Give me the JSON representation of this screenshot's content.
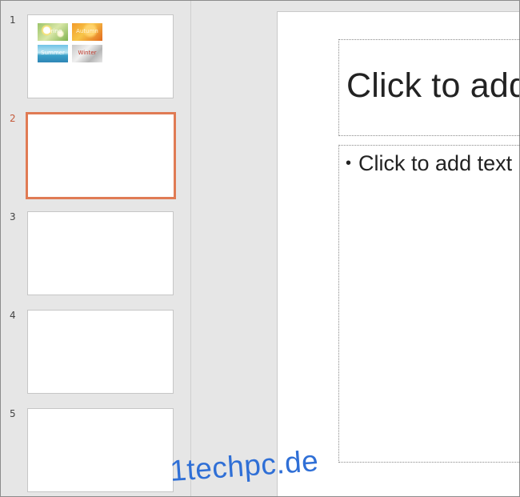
{
  "slides": [
    {
      "number": "1",
      "tiles": [
        "Spring",
        "Autumn",
        "Summer",
        "Winter"
      ]
    },
    {
      "number": "2"
    },
    {
      "number": "3"
    },
    {
      "number": "4"
    },
    {
      "number": "5"
    }
  ],
  "active_slide_color": "#e07b54",
  "editor": {
    "title_placeholder": "Click to add title",
    "body_bullet": "•",
    "body_placeholder": "Click to add text"
  },
  "watermark": "1techpc.de"
}
